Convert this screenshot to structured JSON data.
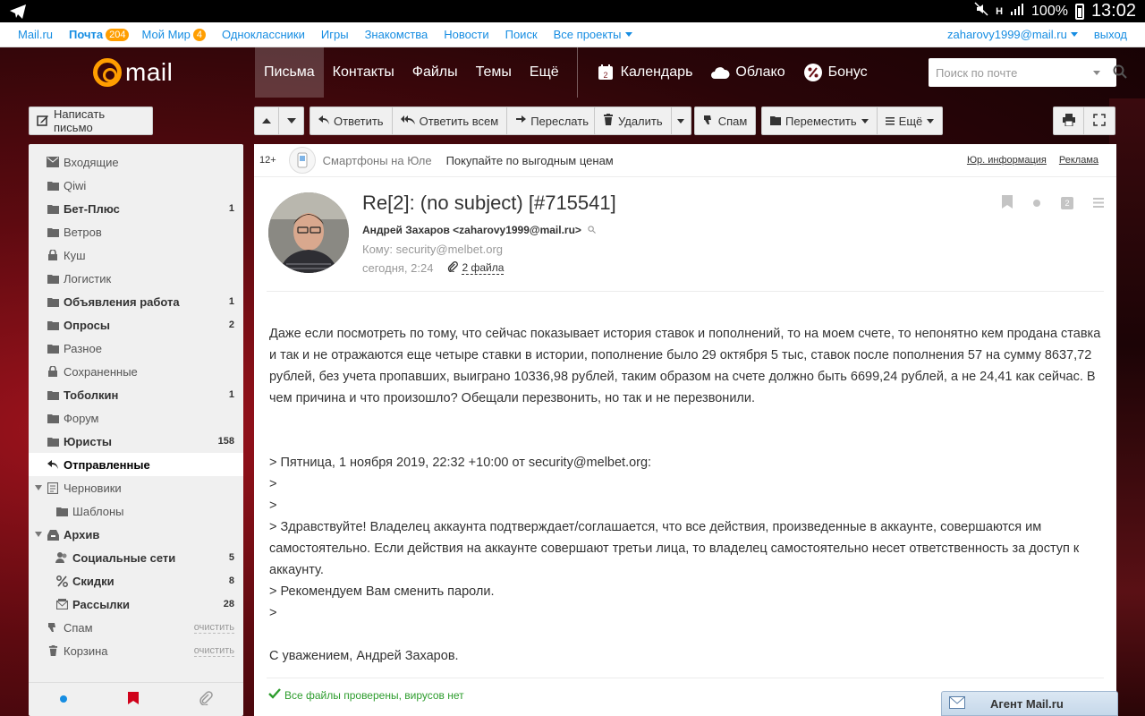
{
  "statusbar": {
    "battery": "100%",
    "time": "13:02"
  },
  "portal": {
    "links": [
      {
        "label": "Mail.ru",
        "badge": null,
        "bold": false
      },
      {
        "label": "Почта",
        "badge": "204",
        "bold": true
      },
      {
        "label": "Мой Мир",
        "badge": "4",
        "bold": false
      },
      {
        "label": "Одноклассники",
        "badge": null,
        "bold": false
      },
      {
        "label": "Игры",
        "badge": null,
        "bold": false
      },
      {
        "label": "Знакомства",
        "badge": null,
        "bold": false
      },
      {
        "label": "Новости",
        "badge": null,
        "bold": false
      },
      {
        "label": "Поиск",
        "badge": null,
        "bold": false
      }
    ],
    "all_projects": "Все проекты",
    "user_email": "zaharovy1999@mail.ru",
    "logout": "выход"
  },
  "header": {
    "logo_text": "mail",
    "nav": [
      "Письма",
      "Контакты",
      "Файлы",
      "Темы",
      "Ещё"
    ],
    "services": [
      "Календарь",
      "Облако",
      "Бонус"
    ],
    "calendar_day": "2",
    "search_placeholder": "Поиск по почте"
  },
  "toolbar": {
    "compose": "Написать письмо",
    "reply": "Ответить",
    "reply_all": "Ответить всем",
    "forward": "Переслать",
    "delete": "Удалить",
    "spam": "Спам",
    "move": "Переместить",
    "more": "Ещё"
  },
  "sidebar": {
    "folders": [
      {
        "name": "Входящие",
        "icon": "inbox-icon",
        "count": "",
        "bold": false,
        "level": 0
      },
      {
        "name": "Qiwi",
        "icon": "folder-icon",
        "count": "",
        "bold": false,
        "level": 0
      },
      {
        "name": "Бет-Плюс",
        "icon": "folder-icon",
        "count": "1",
        "bold": true,
        "level": 0
      },
      {
        "name": "Ветров",
        "icon": "folder-icon",
        "count": "",
        "bold": false,
        "level": 0
      },
      {
        "name": "Куш",
        "icon": "lock-icon",
        "count": "",
        "bold": false,
        "level": 0
      },
      {
        "name": "Логистик",
        "icon": "folder-icon",
        "count": "",
        "bold": false,
        "level": 0
      },
      {
        "name": "Объявления работа",
        "icon": "folder-icon",
        "count": "1",
        "bold": true,
        "level": 0
      },
      {
        "name": "Опросы",
        "icon": "folder-icon",
        "count": "2",
        "bold": true,
        "level": 0
      },
      {
        "name": "Разное",
        "icon": "folder-icon",
        "count": "",
        "bold": false,
        "level": 0
      },
      {
        "name": "Сохраненные",
        "icon": "lock-icon",
        "count": "",
        "bold": false,
        "level": 0
      },
      {
        "name": "Тоболкин",
        "icon": "folder-icon",
        "count": "1",
        "bold": true,
        "level": 0
      },
      {
        "name": "Форум",
        "icon": "folder-icon",
        "count": "",
        "bold": false,
        "level": 0
      },
      {
        "name": "Юристы",
        "icon": "folder-icon",
        "count": "158",
        "bold": true,
        "level": 0
      },
      {
        "name": "Отправленные",
        "icon": "sent-icon",
        "count": "",
        "bold": true,
        "level": 0,
        "active": true
      },
      {
        "name": "Черновики",
        "icon": "drafts-icon",
        "count": "",
        "bold": false,
        "level": 0,
        "expanded": true
      },
      {
        "name": "Шаблоны",
        "icon": "folder-icon",
        "count": "",
        "bold": false,
        "level": 1
      },
      {
        "name": "Архив",
        "icon": "archive-icon",
        "count": "",
        "bold": true,
        "level": 0,
        "expanded": true
      },
      {
        "name": "Социальные сети",
        "icon": "social-icon",
        "count": "5",
        "bold": true,
        "level": 1
      },
      {
        "name": "Скидки",
        "icon": "percent-icon",
        "count": "8",
        "bold": true,
        "level": 1
      },
      {
        "name": "Рассылки",
        "icon": "newsletter-icon",
        "count": "28",
        "bold": true,
        "level": 1
      },
      {
        "name": "Спам",
        "icon": "spam-icon",
        "count": "",
        "bold": false,
        "level": 0,
        "clean": "очистить"
      },
      {
        "name": "Корзина",
        "icon": "trash-icon",
        "count": "",
        "bold": false,
        "level": 0,
        "clean": "очистить"
      }
    ]
  },
  "ad": {
    "age": "12+",
    "name": "Смартфоны на Юле",
    "text": "Покупайте по выгодным ценам",
    "legal": "Юр. информация",
    "advert": "Реклама"
  },
  "message": {
    "subject": "Re[2]: (no subject) [#715541]",
    "from": "Андрей Захаров <zaharovy1999@mail.ru>",
    "to": "Кому: security@melbet.org",
    "date": "сегодня, 2:24",
    "files": "2 файла",
    "label_count": "2",
    "body_main": "Даже если посмотреть по тому, что сейчас показывает история ставок и пополнений, то на моем счете, то непонятно кем продана ставка и так и не отражаются еще четыре ставки в истории, пополнение было 29 октября 5 тыс, ставок после пополнения 57 на сумму 8637,72 рублей, без учета пропавших, выиграно 10336,98 рублей, таким образом на счете должно быть 6699,24 рублей, а не 24,41 как сейчас. В чем причина и что произошло? Обещали перезвонить, но так и не перезвонили.",
    "quote_header": "> Пятница, 1 ноября 2019, 22:32 +10:00 от security@melbet.org:",
    "quote_gt1": ">",
    "quote_gt2": ">",
    "quote_body": "> Здравствуйте! Владелец аккаунта подтверждает/соглашается, что все действия, произведенные в аккаунте, совершаются им самостоятельно. Если действия на аккаунте совершают третьи лица, то владелец самостоятельно несет ответственность за доступ к аккаунту.",
    "quote_reco": "> Рекомендуем Вам сменить пароли.",
    "quote_gt3": ">",
    "signature": "С уважением, Андрей Захаров.",
    "virus_ok": "Все файлы проверены, вирусов нет"
  },
  "agent": {
    "label": "Агент Mail.ru"
  },
  "colors": {
    "accent": "#168de2",
    "orange": "#ff9e00",
    "ok_green": "#2e9d2e"
  }
}
